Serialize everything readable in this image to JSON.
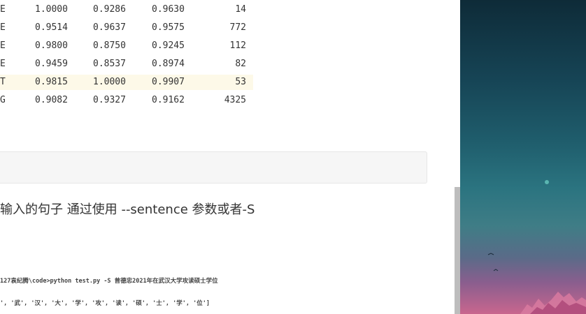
{
  "report": {
    "rows": [
      {
        "label": "E",
        "precision": "1.0000",
        "recall": "0.9286",
        "f1": "0.9630",
        "support": "14"
      },
      {
        "label": "E",
        "precision": "0.9514",
        "recall": "0.9637",
        "f1": "0.9575",
        "support": "772"
      },
      {
        "label": "E",
        "precision": "0.9800",
        "recall": "0.8750",
        "f1": "0.9245",
        "support": "112"
      },
      {
        "label": "E",
        "precision": "0.9459",
        "recall": "0.8537",
        "f1": "0.8974",
        "support": "82"
      },
      {
        "label": "T",
        "precision": "0.9815",
        "recall": "1.0000",
        "f1": "0.9907",
        "support": "53"
      },
      {
        "label": "G",
        "precision": "0.9082",
        "recall": "0.9327",
        "f1": "0.9162",
        "support": "4325"
      }
    ]
  },
  "paragraph": "输入的句子 通过使用 --sentence 参数或者-S",
  "screenshot": {
    "command_line": "127袁纪腾\\code>python test.py -S 曾德忠2021年在武汉大学攻读硕士学位",
    "output_line": "', '武', '汉', '大', '学', '攻', '读', '硕', '士', '学', '位']"
  },
  "colors": {
    "highlight_row": "#fdf9e8",
    "code_block_bg": "#f6f6f6",
    "scrollbar": "#bdbdbd"
  }
}
